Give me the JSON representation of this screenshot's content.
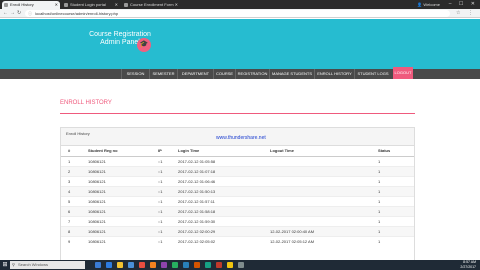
{
  "browser": {
    "tabs": [
      {
        "label": "Enroll History",
        "active": true
      },
      {
        "label": "Student Login portal",
        "active": false
      },
      {
        "label": "Course Enrollment Form",
        "active": false
      }
    ],
    "profile": "Welcome",
    "url": "localhost/onlinecourse/admin/enroll-history.php",
    "window_controls": "– ☐ ✕"
  },
  "header": {
    "title_line1": "Course Registration",
    "title_line2": "Admin Panel",
    "logo_glyph": "🎓"
  },
  "nav": {
    "items": [
      "SESSION",
      "SEMESTER",
      "DEPARTMENT",
      "COURSE",
      "REGISTRATION",
      "MANAGE STUDENTS",
      "ENROLL HISTORY",
      "STUDENT LOGS",
      "LOGOUT"
    ]
  },
  "main": {
    "page_title": "ENROLL HISTORY",
    "panel_title": "Enroll History",
    "watermark": "www.thundershare.net",
    "columns": [
      "#",
      "Student Reg no",
      "IP",
      "Login Time",
      "Logout Time",
      "Status"
    ],
    "rows": [
      [
        "1",
        "10806121",
        "::1",
        "2017-02-12 01:05:58",
        "",
        "1"
      ],
      [
        "2",
        "10806121",
        "::1",
        "2017-02-12 01:07:18",
        "",
        "1"
      ],
      [
        "3",
        "10806121",
        "::1",
        "2017-02-12 01:06:46",
        "",
        "1"
      ],
      [
        "4",
        "10806121",
        "::1",
        "2017-02-12 01:50:13",
        "",
        "1"
      ],
      [
        "5",
        "10806121",
        "::1",
        "2017-02-12 01:57:11",
        "",
        "1"
      ],
      [
        "6",
        "10806121",
        "::1",
        "2017-02-12 01:58:18",
        "",
        "1"
      ],
      [
        "7",
        "10806121",
        "::1",
        "2017-02-12 01:59:30",
        "",
        "1"
      ],
      [
        "8",
        "10806121",
        "::1",
        "2017-02-12 02:00:29",
        "12-02-2017 02:00:40 AM",
        "1"
      ],
      [
        "9",
        "10806121",
        "::1",
        "2017-02-12 02:05:02",
        "12-02-2017 02:05:12 AM",
        "1"
      ]
    ]
  },
  "taskbar": {
    "search_placeholder": "Search Windows",
    "time": "8:57 AM",
    "date": "2/27/2017"
  },
  "colors": {
    "header_bg": "#26bcd0",
    "accent": "#ef5a7d",
    "nav_bg": "#4a4a4a"
  }
}
